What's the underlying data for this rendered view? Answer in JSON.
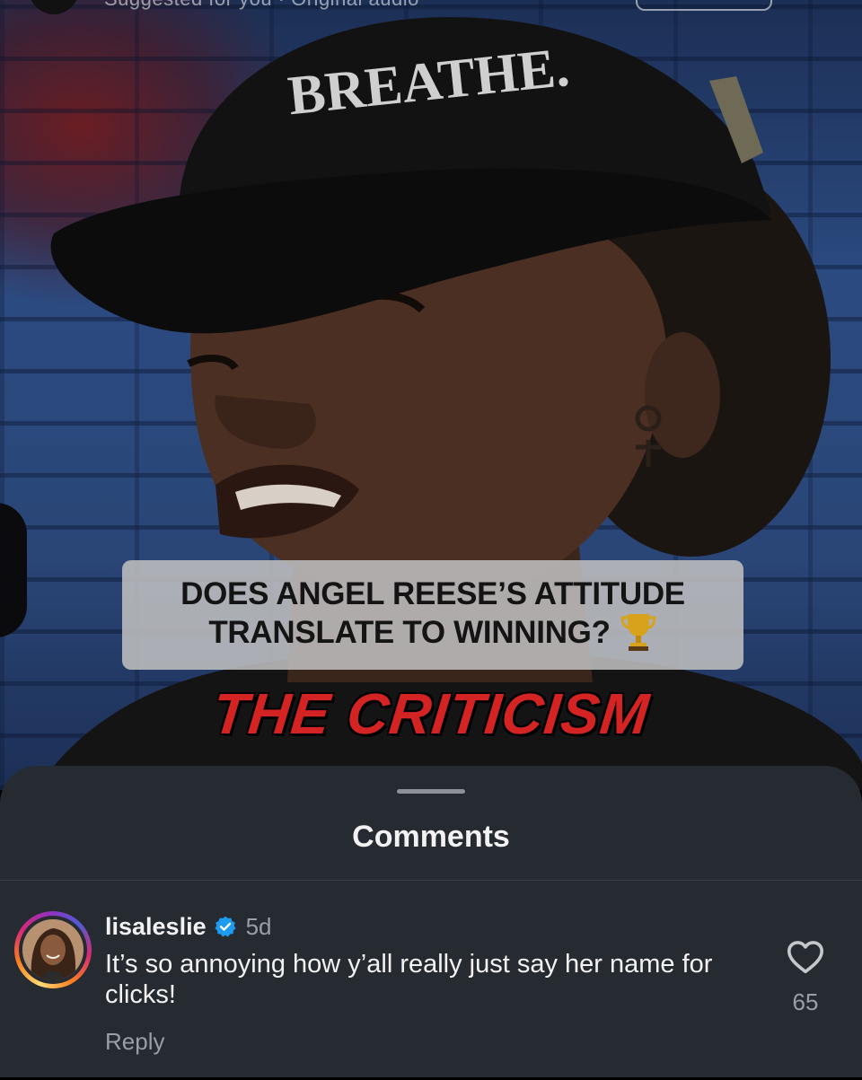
{
  "video": {
    "header_text": "Suggested for you · Original audio",
    "caption_line1": "DOES ANGEL REESE’S ATTITUDE",
    "caption_line2": "TRANSLATE TO WINNING?",
    "caption_emoji": "trophy-icon",
    "hat_text": "BREATHE.",
    "overlay_title": "THE CRITICISM"
  },
  "sheet": {
    "title": "Comments"
  },
  "comments": [
    {
      "username": "lisaleslie",
      "verified": true,
      "time": "5d",
      "text": "It’s so annoying how y’all really just say her name for clicks!",
      "reply_label": "Reply",
      "likes": "65"
    }
  ],
  "colors": {
    "sheet_bg": "#262a31",
    "verified_blue": "#1d9bf0",
    "overlay_red": "#d42323",
    "caption_bg": "#bebebe"
  }
}
